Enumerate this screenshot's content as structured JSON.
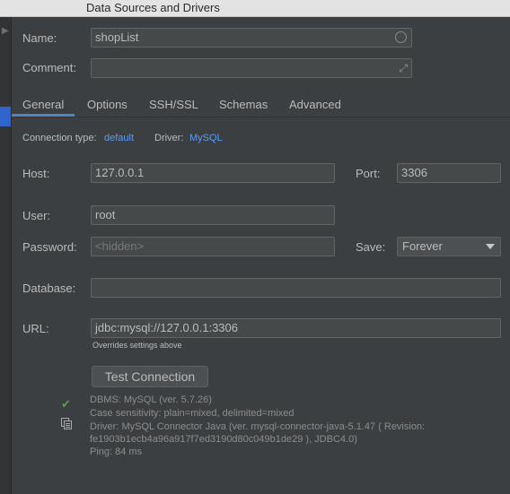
{
  "window": {
    "title": "Data Sources and Drivers"
  },
  "form": {
    "name_label": "Name:",
    "name_value": "shopList",
    "comment_label": "Comment:",
    "comment_value": ""
  },
  "tabs": [
    {
      "label": "General",
      "active": true
    },
    {
      "label": "Options",
      "active": false
    },
    {
      "label": "SSH/SSL",
      "active": false
    },
    {
      "label": "Schemas",
      "active": false
    },
    {
      "label": "Advanced",
      "active": false
    }
  ],
  "connection": {
    "type_label": "Connection type:",
    "type_value": "default",
    "driver_label": "Driver:",
    "driver_value": "MySQL"
  },
  "host": {
    "label": "Host:",
    "value": "127.0.0.1"
  },
  "port": {
    "label": "Port:",
    "value": "3306"
  },
  "user": {
    "label": "User:",
    "value": "root"
  },
  "password": {
    "label": "Password:",
    "placeholder": "<hidden>"
  },
  "save": {
    "label": "Save:",
    "value": "Forever"
  },
  "database": {
    "label": "Database:",
    "value": ""
  },
  "url": {
    "label": "URL:",
    "value": "jdbc:mysql://127.0.0.1:3306",
    "hint": "Overrides settings above"
  },
  "test_button": "Test Connection",
  "status": {
    "lines": [
      "DBMS: MySQL (ver. 5.7.26)",
      "Case sensitivity: plain=mixed, delimited=mixed",
      "Driver: MySQL Connector Java (ver. mysql-connector-java-5.1.47 ( Revision:",
      "fe1903b1ecb4a96a917f7ed3190d80c049b1de29 ), JDBC4.0)",
      "Ping: 84 ms"
    ]
  },
  "colors": {
    "accent": "#589df6",
    "tab_underline": "#4a88c7",
    "success": "#5e9b4f"
  }
}
